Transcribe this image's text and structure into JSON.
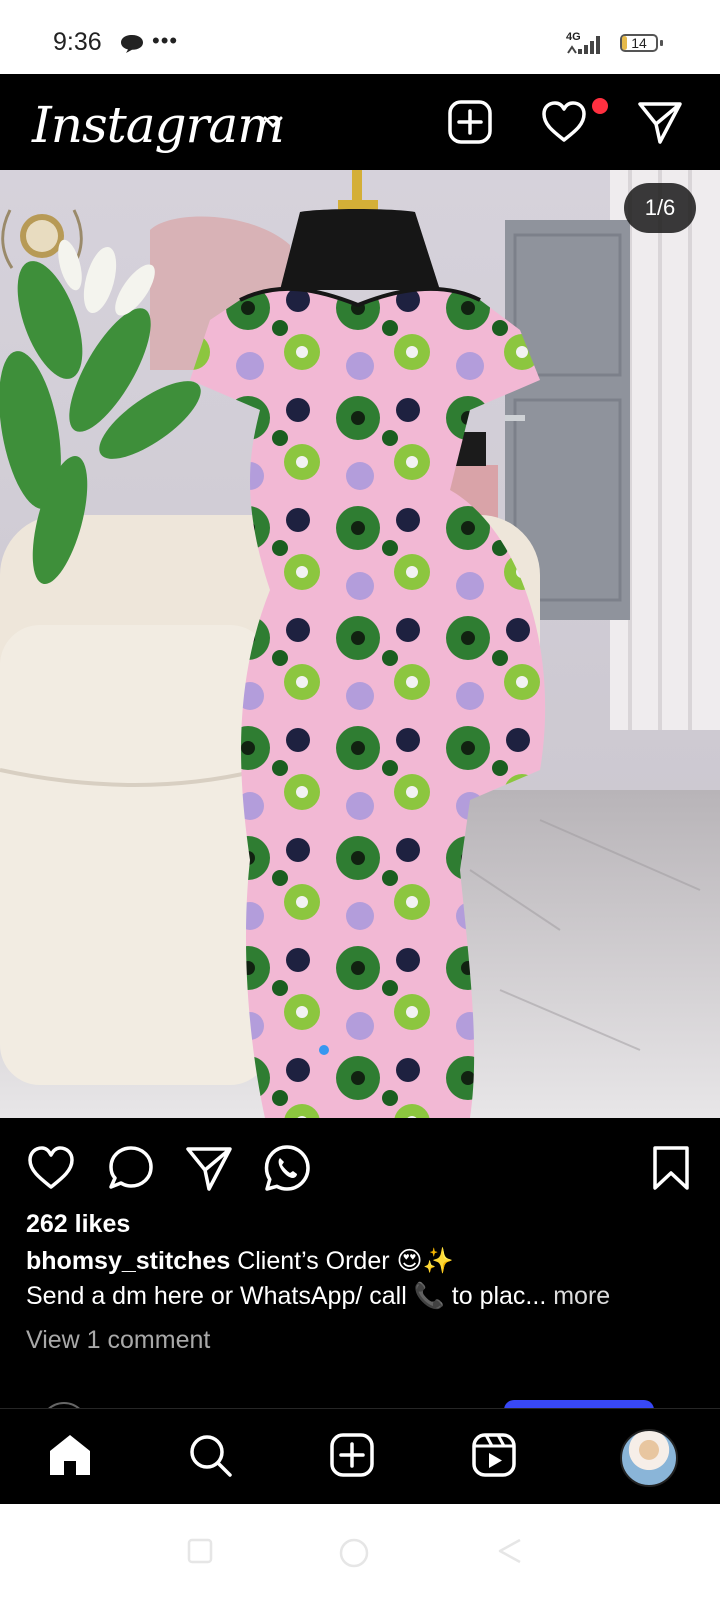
{
  "status_bar": {
    "time": "9:36",
    "dots": "•••",
    "network": "4G",
    "battery": "14",
    "battery_level_percent": 14,
    "icons": [
      "chat-bubble-icon",
      "more-dots-icon",
      "signal-icon",
      "battery-icon"
    ]
  },
  "header": {
    "logo": "Instagram",
    "icons": [
      "chevron-down-icon",
      "new-post-icon",
      "heart-icon",
      "direct-message-icon"
    ],
    "notification_dot_color": "#ff3040"
  },
  "post": {
    "image_counter": "1/6",
    "image_description_icon": "photo",
    "actions": [
      "like-icon",
      "comment-icon",
      "share-icon",
      "whatsapp-icon",
      "save-icon"
    ],
    "likes": "262 likes",
    "username": "bhomsy_stitches",
    "caption_line1": " Client’s Order 😍✨",
    "caption_line2": "Send a dm here or WhatsApp/ call 📞 to plac...",
    "more_label": " more",
    "view_comments": "View 1 comment"
  },
  "bottom_nav": {
    "items": [
      "home-icon",
      "search-icon",
      "create-icon",
      "reels-icon",
      "profile-avatar"
    ]
  },
  "colors": {
    "background": "#000000",
    "text_primary": "#ffffff",
    "text_secondary": "#a8a8a8",
    "accent_blue": "#3848f6",
    "notification_red": "#ff3040"
  }
}
